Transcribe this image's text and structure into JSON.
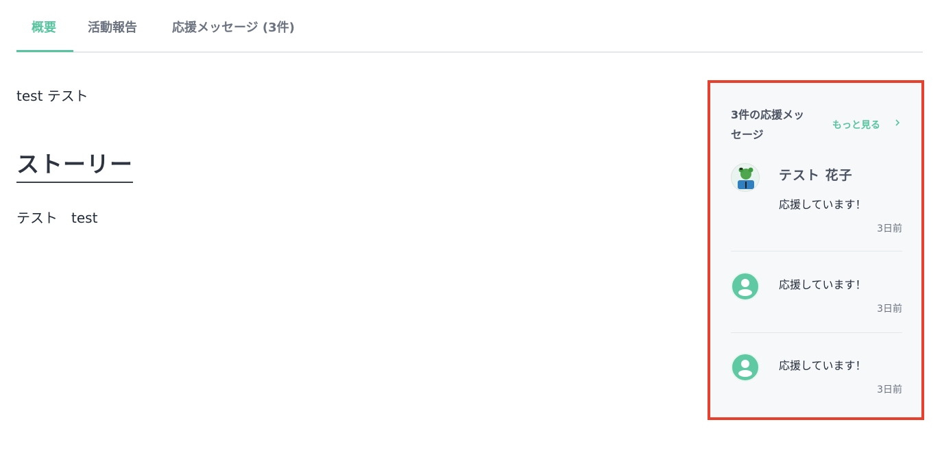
{
  "tabs": [
    {
      "label": "概要",
      "active": true
    },
    {
      "label": "活動報告",
      "active": false
    },
    {
      "label": "応援メッセージ (3件)",
      "active": false
    }
  ],
  "main": {
    "summary": "test テスト",
    "story_heading": "ストーリー",
    "story_body": "テスト　test"
  },
  "panel": {
    "title_line1": "3件の応援メッ",
    "title_line2": "セージ",
    "more_label": "もっと見る",
    "more_icon": "chevron-right-icon",
    "messages": [
      {
        "name": "テスト 花子",
        "text": "応援しています！",
        "time": "3日前",
        "avatar": "photo-avatar"
      },
      {
        "name": "",
        "text": "応援しています！",
        "time": "3日前",
        "avatar": "default-user-avatar"
      },
      {
        "name": "",
        "text": "応援しています！",
        "time": "3日前",
        "avatar": "default-user-avatar"
      }
    ]
  },
  "colors": {
    "accent": "#58c49f",
    "highlight_border": "#e8402c",
    "panel_bg": "#f7f8fa",
    "heading": "#2d3440"
  }
}
